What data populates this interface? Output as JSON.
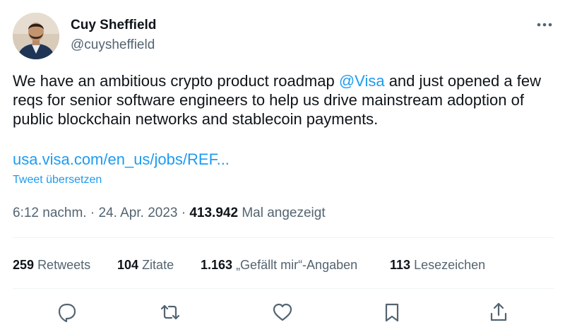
{
  "author": {
    "name": "Cuy Sheffield",
    "handle": "@cuysheffield",
    "avatar_icon": "profile-photo"
  },
  "tweet": {
    "text_part1": "We have an ambitious crypto product roadmap ",
    "mention": "@Visa",
    "text_part2": " and just opened a few reqs for senior software engineers to help us drive mainstream adoption of public blockchain networks and stablecoin payments.",
    "link": "usa.visa.com/en_us/jobs/REF...",
    "translate_label": "Tweet übersetzen"
  },
  "meta": {
    "time": "6:12 nachm.",
    "separator": "·",
    "date": "24. Apr. 2023",
    "separator2": "·",
    "views": "413.942",
    "views_label": "Mal angezeigt"
  },
  "stats": {
    "retweets_count": "259",
    "retweets_label": "Retweets",
    "quotes_count": "104",
    "quotes_label": "Zitate",
    "likes_count": "1.163",
    "likes_label": "„Gefällt mir“-Angaben",
    "bookmarks_count": "113",
    "bookmarks_label": "Lesezeichen"
  },
  "colors": {
    "accent": "#1d9bf0",
    "text": "#0f1419",
    "secondary": "#536471",
    "icon": "#536471",
    "divider": "#eff3f4"
  },
  "icons": {
    "more": "more-horizontal-icon",
    "reply": "reply-icon",
    "retweet": "retweet-icon",
    "like": "heart-icon",
    "bookmark": "bookmark-icon",
    "share": "share-icon"
  }
}
